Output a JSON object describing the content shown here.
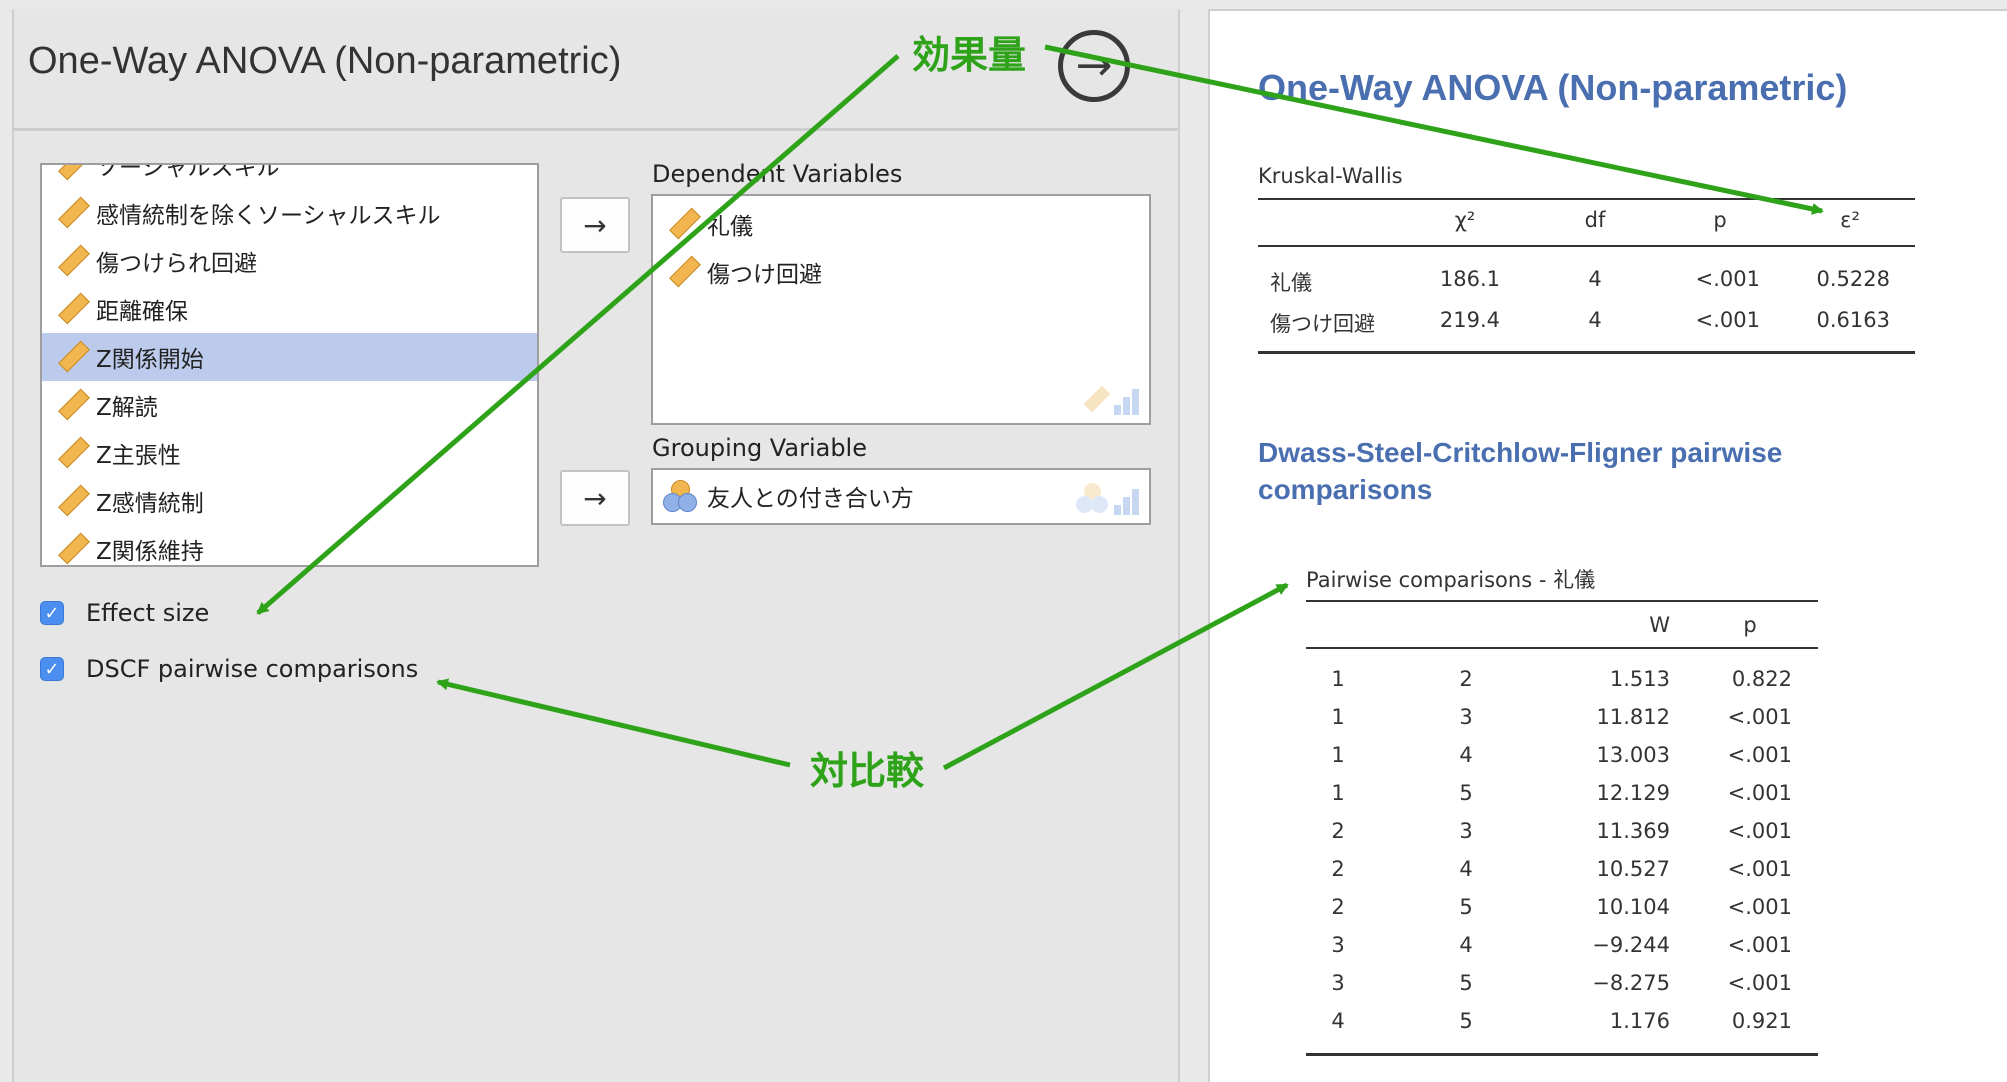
{
  "analysis": {
    "title": "One-Way ANOVA (Non-parametric)"
  },
  "variables": [
    "ソーシャルスキル",
    "感情統制を除くソーシャルスキル",
    "傷つけられ回避",
    "距離確保",
    "Z関係開始",
    "Z解読",
    "Z主張性",
    "Z感情統制",
    "Z関係維持"
  ],
  "selected_variable": "Z関係開始",
  "mover_glyph": "→",
  "dependent": {
    "label": "Dependent Variables",
    "items": [
      "礼儀",
      "傷つけ回避"
    ]
  },
  "grouping": {
    "label": "Grouping Variable",
    "items": [
      "友人との付き合い方"
    ]
  },
  "options": {
    "effect_size": {
      "label": "Effect size",
      "checked": true
    },
    "dscf": {
      "label": "DSCF pairwise comparisons",
      "checked": true
    }
  },
  "results": {
    "title": "One-Way ANOVA (Non-parametric)",
    "kw": {
      "subtitle": "Kruskal-Wallis",
      "headers": [
        "",
        "χ²",
        "df",
        "p",
        "ε²"
      ],
      "rows": [
        [
          "礼儀",
          "186.1",
          "4",
          "<.001",
          "0.5228"
        ],
        [
          "傷つけ回避",
          "219.4",
          "4",
          "<.001",
          "0.6163"
        ]
      ]
    },
    "dscf_title_1": "Dwass-Steel-Critchlow-Fligner pairwise",
    "dscf_title_2": "comparisons",
    "pairwise": {
      "subtitle": "Pairwise comparisons - 礼儀",
      "headers": [
        "",
        "",
        "W",
        "p"
      ],
      "rows": [
        [
          "1",
          "2",
          "1.513",
          "0.822"
        ],
        [
          "1",
          "3",
          "11.812",
          "<.001"
        ],
        [
          "1",
          "4",
          "13.003",
          "<.001"
        ],
        [
          "1",
          "5",
          "12.129",
          "<.001"
        ],
        [
          "2",
          "3",
          "11.369",
          "<.001"
        ],
        [
          "2",
          "4",
          "10.527",
          "<.001"
        ],
        [
          "2",
          "5",
          "10.104",
          "<.001"
        ],
        [
          "3",
          "4",
          "−9.244",
          "<.001"
        ],
        [
          "3",
          "5",
          "−8.275",
          "<.001"
        ],
        [
          "4",
          "5",
          "1.176",
          "0.921"
        ]
      ]
    }
  },
  "annotations": {
    "effect": "効果量",
    "compare": "対比較"
  },
  "colors": {
    "annotation": "#2ea31a",
    "heading": "#4a6fb0",
    "selection": "#bccbeb",
    "checkbox": "#4a8ef0"
  },
  "icons": {
    "run": "arrow-circle-right-icon",
    "continuous": "ruler-icon",
    "nominal": "nominal-circles-icon"
  }
}
